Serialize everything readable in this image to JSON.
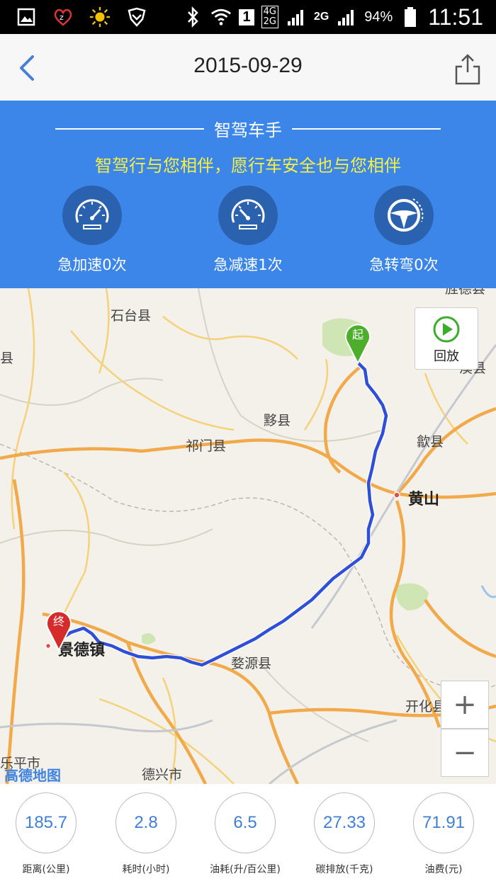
{
  "status_bar": {
    "signal_4g": "4G",
    "signal_2g_top": "2G",
    "signal_2g": "2G",
    "sim": "1",
    "battery": "94%",
    "time": "11:51"
  },
  "nav": {
    "title": "2015-09-29"
  },
  "banner": {
    "title": "智驾车手",
    "slogan": "智驾行与您相伴，愿行车安全也与您相伴",
    "stats": [
      {
        "label": "急加速0次",
        "icon": "speedometer-icon"
      },
      {
        "label": "急减速1次",
        "icon": "speedometer-icon"
      },
      {
        "label": "急转弯0次",
        "icon": "steering-wheel-icon"
      }
    ]
  },
  "map": {
    "labels": {
      "shitai": "石台县",
      "yixian": "黟县",
      "qimen": "祁门县",
      "shexian": "歙县",
      "huangshan": "黄山",
      "jingdezhen": "景德镇",
      "wuyuan": "婺源县",
      "kaihua": "开化县",
      "dexing": "德兴市",
      "xixi": "溪县",
      "leping": "乐平市",
      "edge_left": "县",
      "edge_top": "旌德县"
    },
    "replay_label": "回放",
    "start_marker": "起",
    "end_marker": "终",
    "zoom_in": "+",
    "zoom_out": "−",
    "logo": "高德地图",
    "route_color": "#2e4fd6"
  },
  "metrics": [
    {
      "value": "185.7",
      "label": "距离(公里)"
    },
    {
      "value": "2.8",
      "label": "耗时(小时)"
    },
    {
      "value": "6.5",
      "label": "油耗(升/百公里)"
    },
    {
      "value": "27.33",
      "label": "碳排放(千克)"
    },
    {
      "value": "71.91",
      "label": "油费(元)"
    }
  ]
}
